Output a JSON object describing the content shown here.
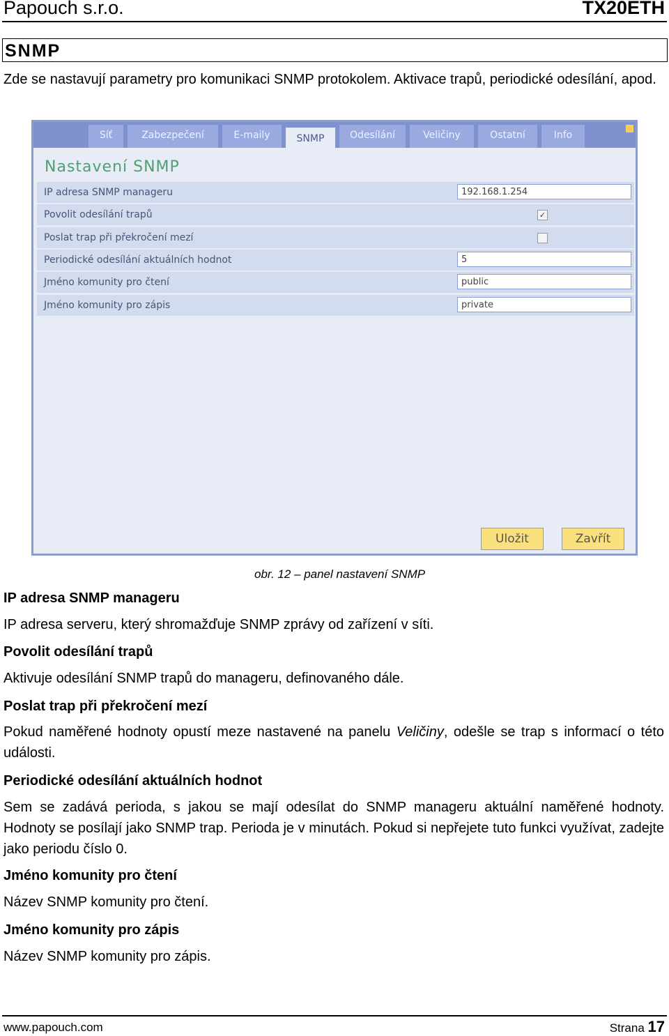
{
  "header": {
    "company": "Papouch s.r.o.",
    "product": "TX20ETH"
  },
  "section": {
    "title": "SNMP",
    "intro": "Zde se nastavují parametry pro komunikaci SNMP protokolem. Aktivace trapů, periodické odesílání, apod."
  },
  "app": {
    "tabs": [
      {
        "label": "Síť",
        "active": false
      },
      {
        "label": "Zabezpečení",
        "active": false
      },
      {
        "label": "E-maily",
        "active": false
      },
      {
        "label": "SNMP",
        "active": true
      },
      {
        "label": "Odesílání",
        "active": false
      },
      {
        "label": "Veličiny",
        "active": false
      },
      {
        "label": "Ostatní",
        "active": false
      },
      {
        "label": "Info",
        "active": false
      }
    ],
    "title": "Nastavení SNMP",
    "rows": [
      {
        "label": "IP adresa SNMP manageru",
        "value": "192.168.1.254"
      },
      {
        "label": "Povolit odesílání trapů",
        "checked": true,
        "check_glyph": "✓"
      },
      {
        "label": "Poslat trap při překročení mezí",
        "checked": false
      },
      {
        "label": "Periodické odesílání aktuálních hodnot",
        "value": "5"
      },
      {
        "label": "Jméno komunity pro čtení",
        "value": "public"
      },
      {
        "label": "Jméno komunity pro zápis",
        "value": "private"
      }
    ],
    "save": "Uložit",
    "close": "Zavřít",
    "colors": {
      "tabbar": "#7f92cf",
      "panel": "#e8ecf7",
      "title": "#4fa070",
      "button": "#fbe07e"
    }
  },
  "caption": "obr. 12 – panel nastavení SNMP",
  "items": [
    {
      "heading": "IP adresa SNMP manageru",
      "text": "IP adresa serveru, který shromažďuje SNMP zprávy od zařízení v síti."
    },
    {
      "heading": "Povolit odesílání trapů",
      "text": "Aktivuje odesílání SNMP trapů do manageru, definovaného dále."
    },
    {
      "heading": "Poslat trap při překročení mezí",
      "text_a": "Pokud naměřené hodnoty opustí meze nastavené na panelu ",
      "text_em": "Veličiny",
      "text_b": ", odešle se trap s informací o této události."
    },
    {
      "heading": "Periodické odesílání aktuálních hodnot",
      "text": "Sem se zadává perioda, s jakou se mají odesílat do SNMP manageru aktuální naměřené hodnoty. Hodnoty se posílají jako SNMP trap. Perioda je v minutách. Pokud si nepřejete tuto funkci využívat, zadejte jako periodu číslo 0."
    },
    {
      "heading": "Jméno komunity pro čtení",
      "text": "Název SNMP komunity pro čtení."
    },
    {
      "heading": "Jméno komunity pro zápis",
      "text": "Název SNMP komunity pro zápis."
    }
  ],
  "footer": {
    "url": "www.papouch.com",
    "page_label": "Strana",
    "page": "17"
  }
}
